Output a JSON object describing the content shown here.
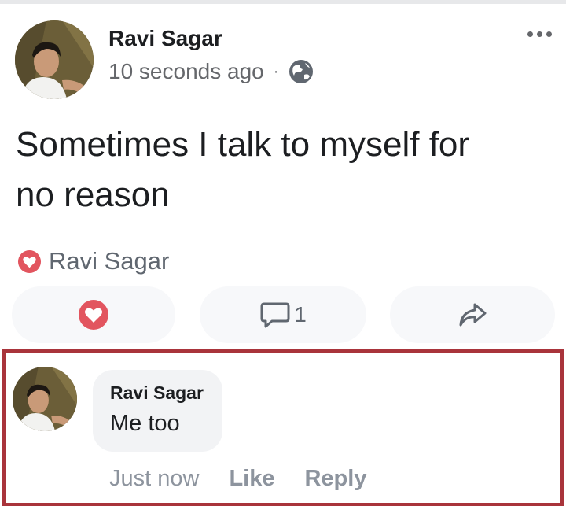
{
  "post": {
    "author": "Ravi Sagar",
    "timestamp": "10 seconds ago",
    "separator": "·",
    "privacy_icon": "globe-icon",
    "body_line1": "Sometimes I talk to myself for",
    "body_line2": "no reason",
    "reaction_icon": "love-reaction-icon",
    "reaction_by": "Ravi Sagar",
    "comment_count": "1"
  },
  "actions": {
    "love_icon": "love-icon",
    "comment_icon": "comment-icon",
    "share_icon": "share-icon"
  },
  "comment": {
    "author": "Ravi Sagar",
    "text": "Me too",
    "time": "Just now",
    "like_label": "Like",
    "reply_label": "Reply"
  },
  "colors": {
    "love": "#e2555f",
    "highlight_frame": "#a9343b",
    "secondary_text": "#65676b",
    "muted_text": "#8d949e"
  }
}
